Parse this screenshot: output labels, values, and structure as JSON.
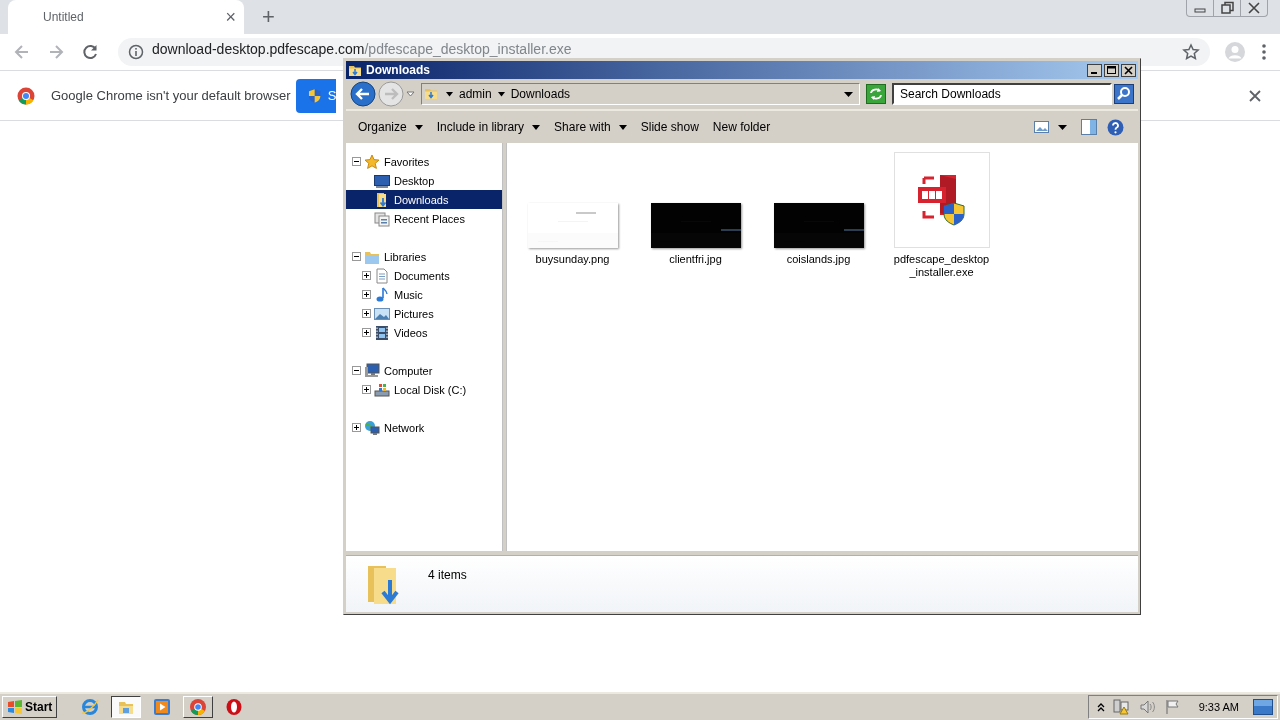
{
  "browser": {
    "tab": {
      "title": "Untitled",
      "close": "×"
    },
    "new_tab": "+",
    "address": {
      "host": "download-desktop.pdfescape.com",
      "path": "/pdfescape_desktop_installer.exe"
    },
    "infobar": {
      "message": "Google Chrome isn't your default browser",
      "button_label": "S"
    }
  },
  "explorer": {
    "title": "Downloads",
    "breadcrumb": [
      "admin",
      "Downloads"
    ],
    "search": {
      "placeholder": "Search Downloads"
    },
    "commands": [
      {
        "label": "Organize",
        "dropdown": true
      },
      {
        "label": "Include in library",
        "dropdown": true
      },
      {
        "label": "Share with",
        "dropdown": true
      },
      {
        "label": "Slide show",
        "dropdown": false
      },
      {
        "label": "New folder",
        "dropdown": false
      }
    ],
    "tree": [
      {
        "label": "Favorites",
        "kind": "star",
        "expanded": true,
        "selected": false,
        "children": [
          {
            "label": "Desktop",
            "kind": "desktop",
            "selected": false
          },
          {
            "label": "Downloads",
            "kind": "downloads",
            "selected": true
          },
          {
            "label": "Recent Places",
            "kind": "recent",
            "selected": false
          }
        ]
      },
      {
        "label": "Libraries",
        "kind": "library",
        "expanded": true,
        "selected": false,
        "children": [
          {
            "label": "Documents",
            "kind": "document",
            "expanded": false,
            "selected": false
          },
          {
            "label": "Music",
            "kind": "music",
            "expanded": false,
            "selected": false
          },
          {
            "label": "Pictures",
            "kind": "pictures",
            "expanded": false,
            "selected": false
          },
          {
            "label": "Videos",
            "kind": "video",
            "expanded": false,
            "selected": false
          }
        ]
      },
      {
        "label": "Computer",
        "kind": "computer",
        "expanded": true,
        "selected": false,
        "children": [
          {
            "label": "Local Disk (C:)",
            "kind": "disk",
            "expanded": false,
            "selected": false
          }
        ]
      },
      {
        "label": "Network",
        "kind": "network",
        "expanded": false,
        "selected": false
      }
    ],
    "files": [
      {
        "name": "buysunday.png",
        "kind": "picture"
      },
      {
        "name": "clientfri.jpg",
        "kind": "picture"
      },
      {
        "name": "coislands.jpg",
        "kind": "picture"
      },
      {
        "name": "pdfescape_desktop _installer.exe",
        "kind": "app"
      }
    ],
    "status": "4 items"
  },
  "taskbar": {
    "start": "Start",
    "items": [
      {
        "kind": "ie",
        "selected": false,
        "running": false
      },
      {
        "kind": "explorer",
        "selected": true,
        "running": true
      },
      {
        "kind": "media",
        "selected": false,
        "running": false
      },
      {
        "kind": "chrome",
        "selected": false,
        "running": true
      },
      {
        "kind": "opera",
        "selected": false,
        "running": false
      }
    ],
    "clock": "9:33 AM"
  }
}
